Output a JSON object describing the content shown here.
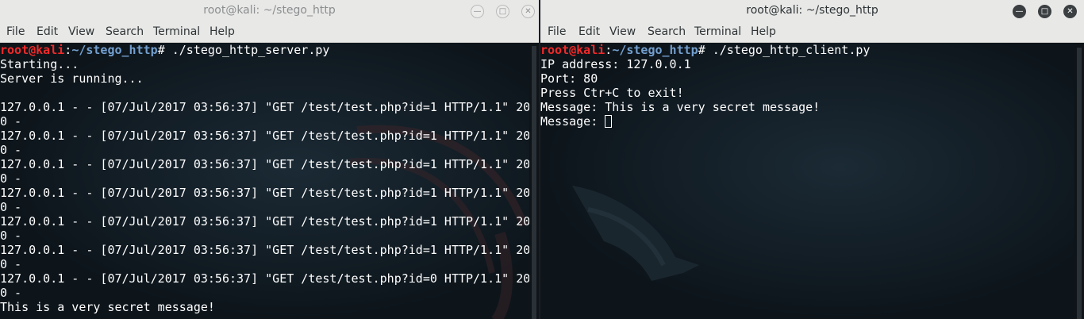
{
  "menu": [
    "File",
    "Edit",
    "View",
    "Search",
    "Terminal",
    "Help"
  ],
  "prompt": {
    "user": "root@kali",
    "sep": ":",
    "path": "~/stego_http",
    "symbol": "# "
  },
  "server": {
    "title": "root@kali: ~/stego_http",
    "command": "./stego_http_server.py",
    "lines": [
      "Starting...",
      "Server is running...",
      "",
      "127.0.0.1 - - [07/Jul/2017 03:56:37] \"GET /test/test.php?id=1 HTTP/1.1\" 20",
      "0 -",
      "127.0.0.1 - - [07/Jul/2017 03:56:37] \"GET /test/test.php?id=1 HTTP/1.1\" 20",
      "0 -",
      "127.0.0.1 - - [07/Jul/2017 03:56:37] \"GET /test/test.php?id=1 HTTP/1.1\" 20",
      "0 -",
      "127.0.0.1 - - [07/Jul/2017 03:56:37] \"GET /test/test.php?id=1 HTTP/1.1\" 20",
      "0 -",
      "127.0.0.1 - - [07/Jul/2017 03:56:37] \"GET /test/test.php?id=1 HTTP/1.1\" 20",
      "0 -",
      "127.0.0.1 - - [07/Jul/2017 03:56:37] \"GET /test/test.php?id=1 HTTP/1.1\" 20",
      "0 -",
      "127.0.0.1 - - [07/Jul/2017 03:56:37] \"GET /test/test.php?id=0 HTTP/1.1\" 20",
      "0 -",
      "This is a very secret message!"
    ]
  },
  "client": {
    "title": "root@kali: ~/stego_http",
    "command": "./stego_http_client.py",
    "lines": [
      "IP address: 127.0.0.1",
      "Port: 80",
      "Press Ctr+C to exit!",
      "Message: This is a very secret message!"
    ],
    "input_prompt": "Message: "
  },
  "icons": {
    "minimize": "minimize-icon",
    "maximize": "maximize-icon",
    "close": "close-icon",
    "logo": "kali-dragon-logo"
  },
  "colors": {
    "user": "#ef2929",
    "path": "#729fcf",
    "text": "#ffffff",
    "background": "#10181f",
    "titlebar": "#e8e8e7"
  }
}
